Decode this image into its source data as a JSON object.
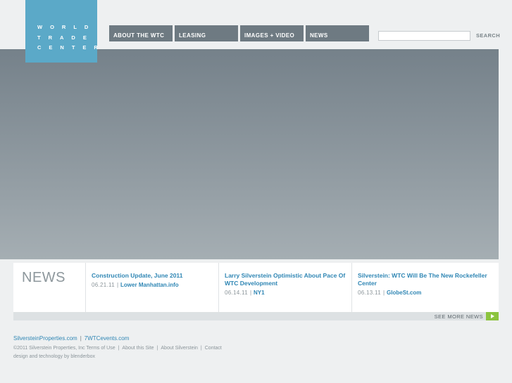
{
  "logo": {
    "line1": "WORLD",
    "line2": "TRADE",
    "line3": "CENTER",
    "color": "#5ba9c8"
  },
  "nav": [
    {
      "label": "ABOUT THE WTC"
    },
    {
      "label": "LEASING"
    },
    {
      "label": "IMAGES + VIDEO"
    },
    {
      "label": "NEWS"
    }
  ],
  "search": {
    "value": "",
    "button_label": "SEARCH"
  },
  "news": {
    "title": "NEWS",
    "items": [
      {
        "headline": "Construction Update, June 2011",
        "date": "06.21.11",
        "source": "Lower Manhattan.info"
      },
      {
        "headline": "Larry Silverstein Optimistic About Pace Of WTC Development",
        "date": "06.14.11",
        "source": "NY1"
      },
      {
        "headline": "Silverstein: WTC Will Be The New Rockefeller Center",
        "date": "06.13.11",
        "source": "GlobeSt.com"
      }
    ],
    "separator": "|",
    "see_more_label": "SEE MORE NEWS",
    "accent_color": "#8cc43f"
  },
  "footer": {
    "site_links": [
      "SilversteinProperties.com",
      "7WTCevents.com"
    ],
    "copyright": "©2011 Silverstein Properties, Inc",
    "legal_links": [
      "Terms of Use",
      "About this Site",
      "About Silverstein",
      "Contact"
    ],
    "credit": "design and technology by blenderbox",
    "separator": "|"
  }
}
